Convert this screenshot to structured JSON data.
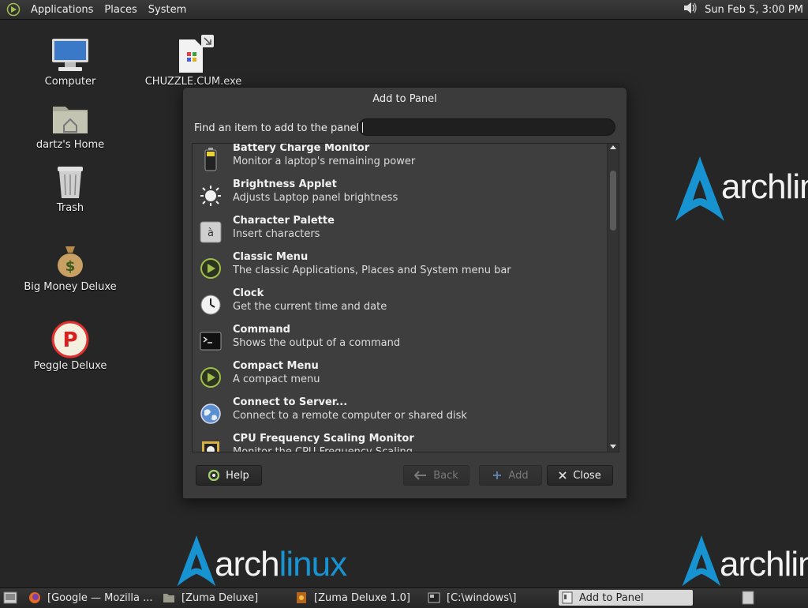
{
  "top_panel": {
    "menus": [
      "Applications",
      "Places",
      "System"
    ],
    "clock": "Sun Feb  5,  3:00 PM",
    "icons": [
      "distro-logo-icon",
      "volume-icon"
    ]
  },
  "desktop": {
    "icons": [
      {
        "label": "Computer",
        "icon": "computer-icon"
      },
      {
        "label": "dartz's Home",
        "icon": "home-folder-icon"
      },
      {
        "label": "Trash",
        "icon": "trash-icon"
      },
      {
        "label": "Big Money Deluxe",
        "icon": "money-bag-icon"
      },
      {
        "label": "Peggle Deluxe",
        "icon": "peggle-icon"
      },
      {
        "label": "CHUZZLE.CUM.exe",
        "icon": "exe-shortcut-icon"
      }
    ],
    "wallpaper_text_left": "arch",
    "wallpaper_text_right": "linux",
    "wallpaper_text_partial": "archlin"
  },
  "dialog": {
    "title": "Add to Panel",
    "find_label": "Find an item to add to the panel:",
    "find_value": "",
    "items": [
      {
        "name": "Battery Charge Monitor",
        "desc": "Monitor a laptop's remaining power",
        "icon": "battery-icon"
      },
      {
        "name": "Brightness Applet",
        "desc": "Adjusts Laptop panel brightness",
        "icon": "brightness-icon"
      },
      {
        "name": "Character Palette",
        "desc": "Insert characters",
        "icon": "character-palette-icon"
      },
      {
        "name": "Classic Menu",
        "desc": "The classic Applications, Places and System menu bar",
        "icon": "menu-icon"
      },
      {
        "name": "Clock",
        "desc": "Get the current time and date",
        "icon": "clock-icon"
      },
      {
        "name": "Command",
        "desc": "Shows the output of a command",
        "icon": "terminal-icon"
      },
      {
        "name": "Compact Menu",
        "desc": "A compact menu",
        "icon": "menu-icon"
      },
      {
        "name": "Connect to Server...",
        "desc": "Connect to a remote computer or shared disk",
        "icon": "globe-icon"
      },
      {
        "name": "CPU Frequency Scaling Monitor",
        "desc": "Monitor the CPU Frequency Scaling",
        "icon": "cpu-icon"
      }
    ],
    "buttons": {
      "help": "Help",
      "back": "Back",
      "add": "Add",
      "close": "Close"
    }
  },
  "taskbar": {
    "tasks": [
      {
        "label": "[Google — Mozilla ...",
        "icon": "firefox-icon"
      },
      {
        "label": "[Zuma Deluxe]",
        "icon": "folder-icon"
      },
      {
        "label": "[Zuma Deluxe 1.0]",
        "icon": "zuma-icon"
      },
      {
        "label": "[C:\\windows\\]",
        "icon": "wine-window-icon"
      },
      {
        "label": "Add to Panel",
        "icon": "panel-icon"
      }
    ]
  },
  "colors": {
    "arch_blue": "#1793d1",
    "panel_bg": "#2b2b2b",
    "dialog_bg": "#3b3b3b"
  }
}
